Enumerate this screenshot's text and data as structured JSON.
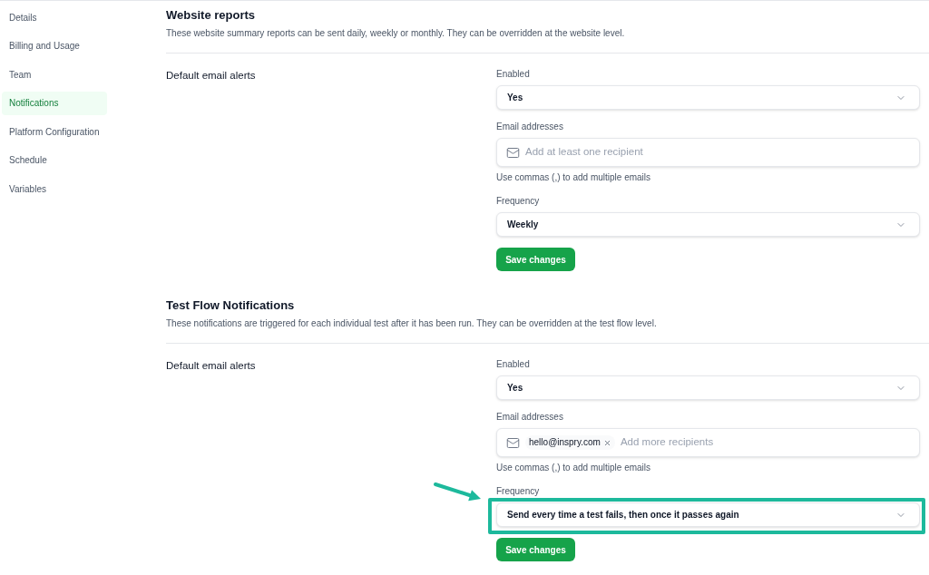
{
  "sidebar": {
    "items": [
      {
        "label": "Details",
        "selected": false
      },
      {
        "label": "Billing and Usage",
        "selected": false
      },
      {
        "label": "Team",
        "selected": false
      },
      {
        "label": "Notifications",
        "selected": true
      },
      {
        "label": "Platform Configuration",
        "selected": false
      },
      {
        "label": "Schedule",
        "selected": false
      },
      {
        "label": "Variables",
        "selected": false
      }
    ]
  },
  "sections": [
    {
      "title": "Website reports",
      "description": "These website summary reports can be sent daily, weekly or monthly. They can be overridden at the website level.",
      "setting_label": "Default email alerts",
      "fields": [
        {
          "kind": "select",
          "label": "Enabled",
          "value": "Yes",
          "highlighted": false
        },
        {
          "kind": "email",
          "label": "Email addresses",
          "placeholder": "Add at least one recipient",
          "hint": "Use commas (,) to add multiple emails",
          "highlighted": false
        },
        {
          "kind": "select",
          "label": "Frequency",
          "value": "Weekly",
          "highlighted": false
        }
      ],
      "save_button": "Save changes"
    },
    {
      "title": "Test Flow Notifications",
      "description": "These notifications are triggered for each individual test after it has been run. They can be overridden at the test flow level.",
      "setting_label": "Default email alerts",
      "fields": [
        {
          "kind": "select",
          "label": "Enabled",
          "value": "Yes",
          "highlighted": false
        },
        {
          "kind": "email",
          "label": "Email addresses",
          "recipients": [
            "hello@inspry.com"
          ],
          "placeholder": "Add more recipients",
          "hint": "Use commas (,) to add multiple emails",
          "highlighted": false
        },
        {
          "kind": "select",
          "label": "Frequency",
          "value": "Send every time a test fails, then once it passes again",
          "highlighted": true
        }
      ],
      "save_button": "Save changes"
    }
  ]
}
